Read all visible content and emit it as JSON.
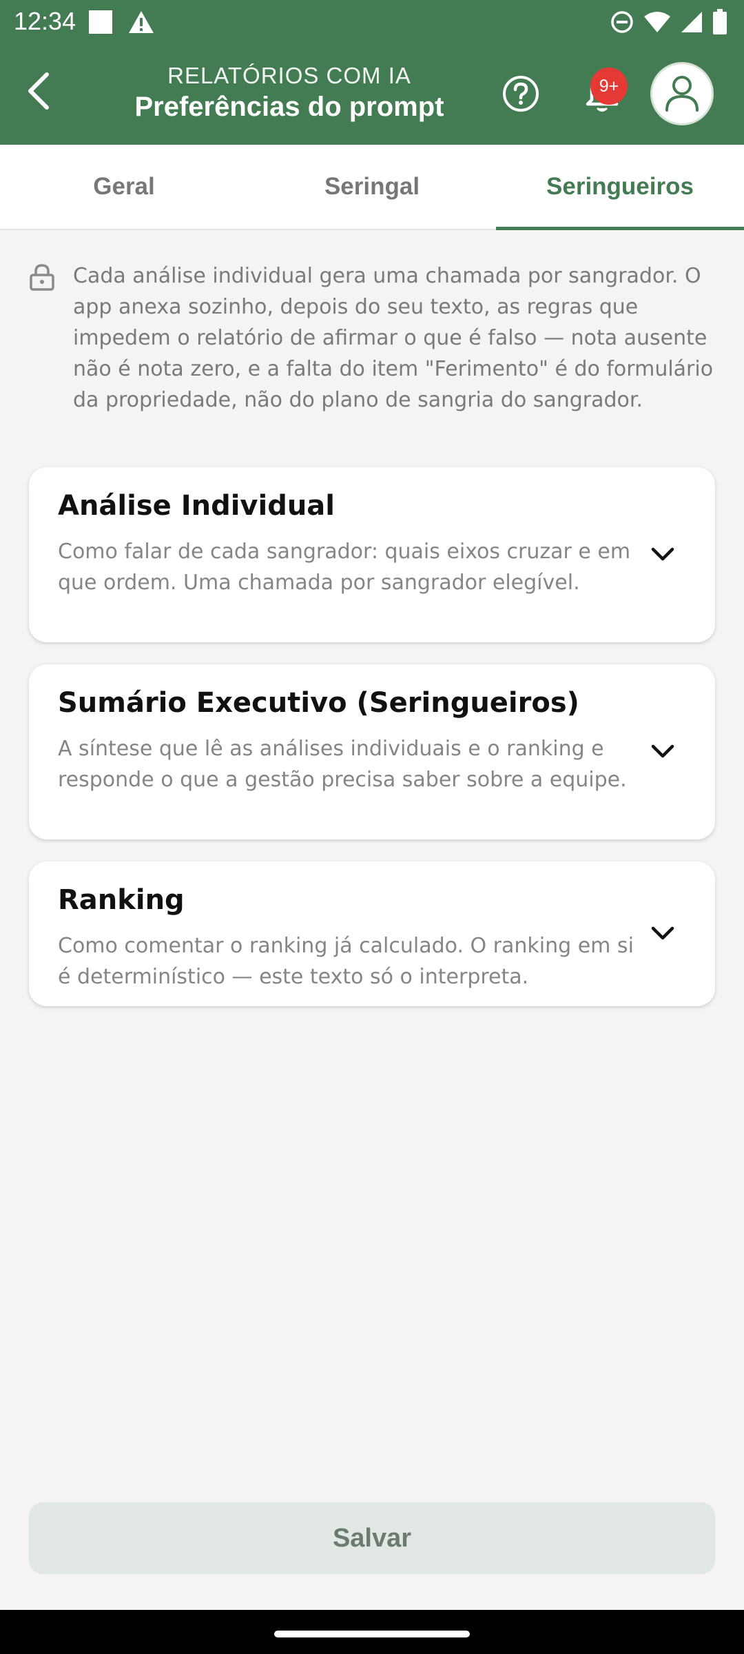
{
  "status_bar": {
    "time": "12:34",
    "icons": [
      "square-notification-icon",
      "warning-icon",
      "do-not-disturb-icon",
      "wifi-icon",
      "cellular-signal-icon",
      "battery-icon"
    ]
  },
  "header": {
    "overline": "RELATÓRIOS COM IA",
    "title": "Preferências do prompt",
    "notification_badge": "9+",
    "color": "#437c52"
  },
  "tabs": [
    {
      "label": "Geral",
      "active": false
    },
    {
      "label": "Seringal",
      "active": false
    },
    {
      "label": "Seringueiros",
      "active": true
    }
  ],
  "info_note": "Cada análise individual gera uma chamada por sangrador. O app anexa sozinho, depois do seu texto, as regras que impedem o relatório de afirmar o que é falso — nota ausente não é nota zero, e a falta do item \"Ferimento\" é do formulário da propriedade, não do plano de sangria do sangrador.",
  "cards": [
    {
      "title": "Análise Individual",
      "description": "Como falar de cada sangrador: quais eixos cruzar e em que ordem. Uma chamada por sangrador elegível."
    },
    {
      "title": "Sumário Executivo (Seringueiros)",
      "description": "A síntese que lê as análises individuais e o ranking e responde o que a gestão precisa saber sobre a equipe."
    },
    {
      "title": "Ranking",
      "description": "Como comentar o ranking já calculado. O ranking em si é determinístico — este texto só o interpreta."
    }
  ],
  "save_button": {
    "label": "Salvar"
  }
}
